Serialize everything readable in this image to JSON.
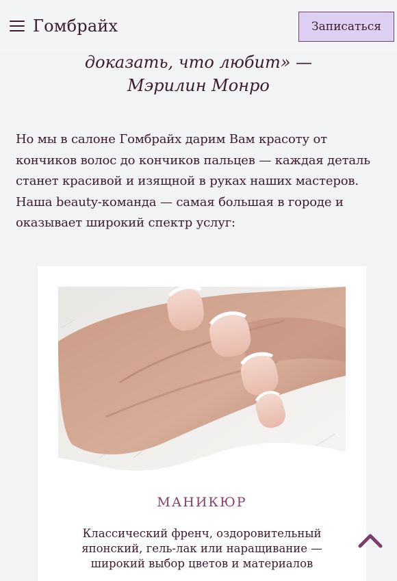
{
  "header": {
    "menu_icon": "hamburger-icon",
    "brand": "Гомбрайх",
    "cta_label": "Записаться",
    "cta_color": "#ddd0f2"
  },
  "quote": {
    "line1": "доказать, что любит» —",
    "author": "Мэрилин Монро"
  },
  "intro": {
    "text": "Но мы в салоне Гомбрайх дарим Вам красоту от кончиков волос до кончиков пальцев — каждая деталь станет красивой и изящной в руках наших мастеров. Наша beauty-команда — самая большая в городе и оказывает широкий спектр услуг:"
  },
  "service_card": {
    "image": "manicure-photo",
    "title": "МАНИКЮР",
    "description": "Классический френч, оздоровительный японский, гель-лак или наращивание — широкий выбор цветов и материалов"
  },
  "scroll_top_icon": "chevron-up-icon",
  "colors": {
    "background": "#f2f3f5",
    "text": "#3b1b2e",
    "accent": "#8a3f6c",
    "card": "#ffffff"
  }
}
